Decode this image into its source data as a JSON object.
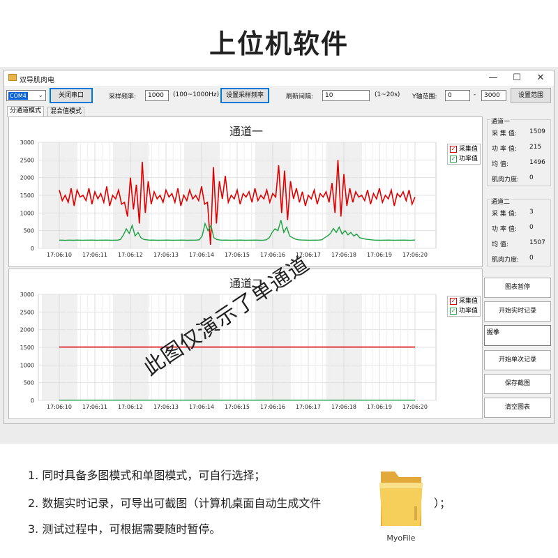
{
  "page_title": "上位机软件",
  "window": {
    "title": "双导肌肉电",
    "minimize": "—",
    "maximize": "☐",
    "close": "✕"
  },
  "toolbar": {
    "port_value": "COM4",
    "close_port_button": "关闭串口",
    "sample_rate_label": "采样频率:",
    "sample_rate_value": "1000",
    "sample_rate_hint": "(100~1000Hz)",
    "set_rate_button": "设置采样频率",
    "refresh_label": "刷新间隔:",
    "refresh_value": "10",
    "refresh_hint": "(1~20s)",
    "yrange_label": "Y轴范围:",
    "ymin_value": "0",
    "ymax_value": "3000",
    "range_dash": "-",
    "set_range_button": "设置范围"
  },
  "tabs": [
    {
      "label": "分通道模式",
      "active": true
    },
    {
      "label": "混合值模式",
      "active": false
    }
  ],
  "sidebar": {
    "channel1": {
      "title": "通道一",
      "rows": [
        {
          "label": "采 集 值:",
          "value": "1509"
        },
        {
          "label": "功 率 值:",
          "value": "215"
        },
        {
          "label": "均    值:",
          "value": "1496"
        },
        {
          "label": "肌肉力度:",
          "value": "0"
        }
      ]
    },
    "channel2": {
      "title": "通道二",
      "rows": [
        {
          "label": "采 集 值:",
          "value": "3"
        },
        {
          "label": "功 率 值:",
          "value": "0"
        },
        {
          "label": "均    值:",
          "value": "1507"
        },
        {
          "label": "肌肉力度:",
          "value": "0"
        }
      ]
    },
    "buttons": {
      "pause": "图表暂停",
      "start_realtime": "开始实时记录",
      "start_single": "开始单次记录",
      "save_screenshot": "保存截图",
      "clear": "清空图表"
    },
    "textbox_value": "握拳"
  },
  "legend": {
    "sample": "采集值",
    "power": "功率值"
  },
  "colors": {
    "sample": "#e00000",
    "power": "#1aa040",
    "accent": "#0078d7"
  },
  "watermark": "此图仅演示了单通道",
  "notes": [
    "1.  同时具备多图模式和单图模式，可自行选择；",
    "2.  数据实时记录，可导出可截图（计算机桌面自动生成文件",
    "）；",
    "3.  测试过程中，可根据需要随时暂停。"
  ],
  "folder_label": "MyoFile",
  "folder_icon": "folder-icon",
  "chart_data": [
    {
      "type": "line",
      "title": "通道一",
      "ylim": [
        0,
        3000
      ],
      "yticks": [
        0,
        500,
        1000,
        1500,
        2000,
        2500,
        3000
      ],
      "categories": [
        "17:06:10",
        "17:06:11",
        "17:06:12",
        "17:06:13",
        "17:06:14",
        "17:06:15",
        "17:06:16",
        "17:06:17",
        "17:06:18",
        "17:06:19",
        "17:06:20"
      ],
      "series": [
        {
          "name": "采集值",
          "color": "#e00000",
          "values": [
            1650,
            1350,
            1500,
            1300,
            1700,
            1200,
            1650,
            1450,
            1500,
            1350,
            1700,
            1250,
            1600,
            1400,
            1550,
            1300,
            1750,
            1200,
            1500,
            1400,
            1650,
            1250,
            1300,
            900,
            2000,
            1100,
            1800,
            700,
            2450,
            1000,
            1900,
            1250,
            1600,
            1400,
            1500,
            1300,
            1650,
            1450,
            1550,
            1300,
            1700,
            1200,
            1500,
            1350,
            1650,
            1400,
            1500,
            1350,
            1750,
            1250,
            1300,
            100,
            2300,
            700,
            1900,
            1400,
            2050,
            1300,
            1500,
            1400,
            1650,
            1250,
            1550,
            1450,
            1600,
            1300,
            1700,
            1350,
            1500,
            1400,
            1650,
            1300,
            1550,
            1450,
            2350,
            1000,
            2200,
            800,
            1900,
            1400,
            1700,
            1300,
            1600,
            1200,
            1500,
            1400,
            1650,
            1250,
            1550,
            1450,
            1600,
            1300,
            1850,
            1000,
            2500,
            900,
            2100,
            1200,
            1700,
            1300,
            1600,
            1450,
            1500,
            1350,
            1650,
            1250,
            1550,
            1400,
            1700,
            1300,
            1500,
            1400,
            1650,
            1200,
            1550,
            1450,
            1600,
            1350,
            1650,
            1250,
            1450
          ]
        },
        {
          "name": "功率值",
          "color": "#1aa040",
          "values": [
            230,
            230,
            225,
            230,
            230,
            228,
            232,
            230,
            228,
            230,
            230,
            232,
            230,
            228,
            230,
            230,
            232,
            230,
            228,
            230,
            230,
            250,
            380,
            550,
            420,
            650,
            350,
            450,
            300,
            250,
            240,
            230,
            232,
            230,
            228,
            230,
            230,
            232,
            230,
            228,
            230,
            230,
            232,
            230,
            228,
            230,
            230,
            232,
            240,
            350,
            700,
            500,
            650,
            300,
            250,
            235,
            230,
            232,
            230,
            228,
            230,
            230,
            232,
            230,
            228,
            230,
            230,
            232,
            230,
            228,
            230,
            240,
            300,
            450,
            550,
            500,
            800,
            450,
            600,
            350,
            300,
            260,
            240,
            235,
            232,
            230,
            228,
            230,
            230,
            232,
            240,
            300,
            350,
            420,
            560,
            450,
            600,
            400,
            500,
            380,
            450,
            350,
            400,
            300,
            280,
            260,
            250,
            240,
            232,
            230,
            228,
            230,
            230,
            232,
            230,
            228,
            230,
            230,
            232,
            230,
            228,
            230,
            235
          ]
        }
      ]
    },
    {
      "type": "line",
      "title": "通道二",
      "ylim": [
        0,
        3000
      ],
      "yticks": [
        0,
        500,
        1000,
        1500,
        2000,
        2500,
        3000
      ],
      "categories": [
        "17:06:10",
        "17:06:11",
        "17:06:12",
        "17:06:13",
        "17:06:14",
        "17:06:15",
        "17:06:16",
        "17:06:17",
        "17:06:18",
        "17:06:19",
        "17:06:20"
      ],
      "series": [
        {
          "name": "采集值",
          "color": "#e00000",
          "values": [
            1507,
            1507,
            1507,
            1507,
            1507,
            1507,
            1507,
            1507,
            1507,
            1507,
            1507
          ]
        },
        {
          "name": "功率值",
          "color": "#1aa040",
          "values": [
            5,
            5,
            5,
            5,
            5,
            5,
            5,
            5,
            5,
            5,
            5
          ]
        }
      ]
    }
  ]
}
